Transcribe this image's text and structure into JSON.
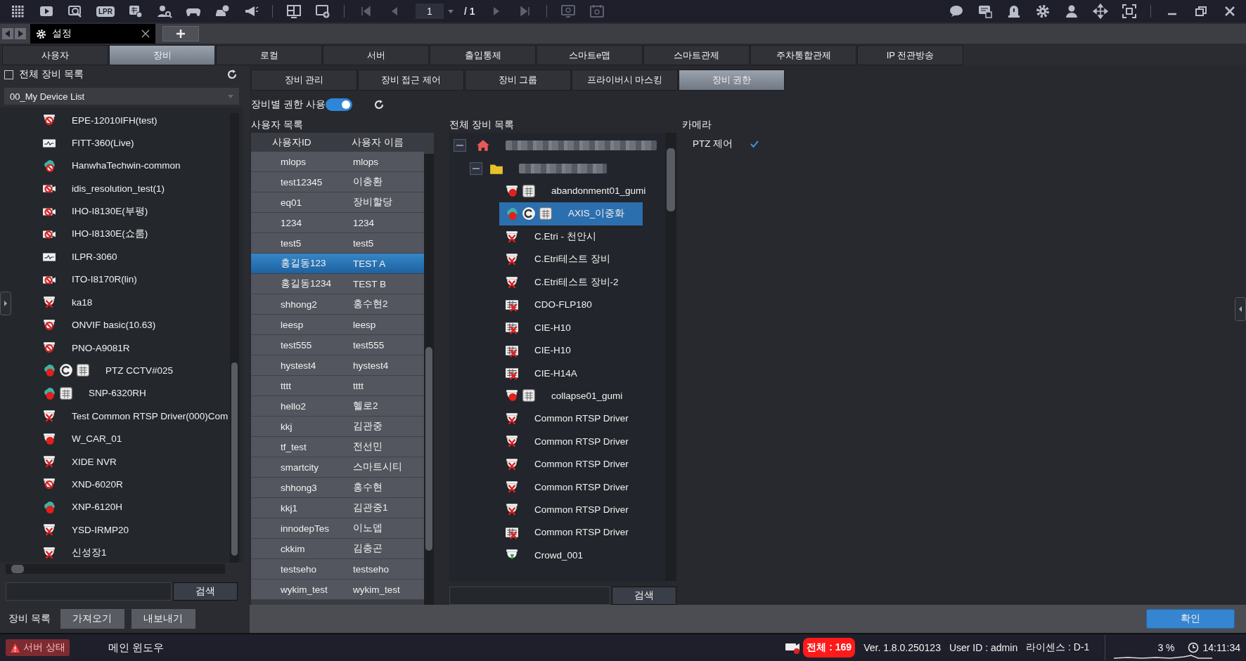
{
  "toolbar": {
    "lpr_label": "LPR",
    "page": "1",
    "page_total": "/ 1"
  },
  "doc_tabs": [
    {
      "label": "설정",
      "selected": true
    }
  ],
  "main_tabs": [
    {
      "label": "사용자",
      "selected": false
    },
    {
      "label": "장비",
      "selected": true
    },
    {
      "label": "로컬",
      "selected": false
    },
    {
      "label": "서버",
      "selected": false
    },
    {
      "label": "출입통제",
      "selected": false
    },
    {
      "label": "스마트e맵",
      "selected": false
    },
    {
      "label": "스마트관제",
      "selected": false
    },
    {
      "label": "주차통합관제",
      "selected": false
    },
    {
      "label": "IP 전관방송",
      "selected": false
    }
  ],
  "left_panel": {
    "all_devices": {
      "label": "전체 장비 목록",
      "checked": false
    },
    "device_list": "00_My Device List",
    "devices": [
      {
        "name": "EPE-12010IFH(test)",
        "kind": "dome-blocked"
      },
      {
        "name": "FITT-360(Live)",
        "kind": "monitor"
      },
      {
        "name": "HanwhaTechwin-common",
        "kind": "cloud-blocked"
      },
      {
        "name": "idis_resolution_test(1)",
        "kind": "box-blocked"
      },
      {
        "name": "IHO-I8130E(부평)",
        "kind": "box-blocked"
      },
      {
        "name": "IHO-I8130E(쇼룸)",
        "kind": "box-blocked"
      },
      {
        "name": "ILPR-3060",
        "kind": "monitor"
      },
      {
        "name": "ITO-I8170R(lin)",
        "kind": "box-blocked"
      },
      {
        "name": "ka18",
        "kind": "dome-x"
      },
      {
        "name": "ONVIF basic(10.63)",
        "kind": "dome-blocked"
      },
      {
        "name": "PNO-A9081R",
        "kind": "dome-blocked"
      },
      {
        "name": "PTZ CCTV#025",
        "kind": "cloud-ptz-grid"
      },
      {
        "name": "SNP-6320RH",
        "kind": "cloud-grid"
      },
      {
        "name": "Test Common RTSP Driver(000)Com",
        "kind": "dome-x"
      },
      {
        "name": "W_CAR_01",
        "kind": "dome-red"
      },
      {
        "name": "XIDE NVR",
        "kind": "dome-x"
      },
      {
        "name": "XND-6020R",
        "kind": "dome-blocked"
      },
      {
        "name": "XNP-6120H",
        "kind": "cloud-red"
      },
      {
        "name": "YSD-IRMP20",
        "kind": "dome-x"
      },
      {
        "name": "신성장1",
        "kind": "dome-x"
      }
    ],
    "search_button": "검색",
    "footer_label": "장비 목록",
    "footer_buttons": [
      "가져오기",
      "내보내기"
    ]
  },
  "sub_tabs": [
    {
      "label": "장비 관리",
      "selected": false
    },
    {
      "label": "장비 접근 제어",
      "selected": false
    },
    {
      "label": "장비 그룹",
      "selected": false
    },
    {
      "label": "프라이버시 마스킹",
      "selected": false
    },
    {
      "label": "장비 권한",
      "selected": true
    }
  ],
  "permission_toggle": {
    "label": "장비별 권한 사용",
    "on": true
  },
  "users": {
    "title": "사용자 목록",
    "columns": [
      "사용자ID",
      "사용자 이름"
    ],
    "rows": [
      {
        "id": "mlops",
        "name": "mlops",
        "selected": false
      },
      {
        "id": "test12345",
        "name": "이충환",
        "selected": false
      },
      {
        "id": "eq01",
        "name": "장비할당",
        "selected": false
      },
      {
        "id": "1234",
        "name": "1234",
        "selected": false
      },
      {
        "id": "test5",
        "name": "test5",
        "selected": false
      },
      {
        "id": "홍길동123",
        "name": "TEST A",
        "selected": true
      },
      {
        "id": "홍길동1234",
        "name": "TEST B",
        "selected": false
      },
      {
        "id": "shhong2",
        "name": "홍수현2",
        "selected": false
      },
      {
        "id": "leesp",
        "name": "leesp",
        "selected": false
      },
      {
        "id": "test555",
        "name": "test555",
        "selected": false
      },
      {
        "id": "hystest4",
        "name": "hystest4",
        "selected": false
      },
      {
        "id": "tttt",
        "name": "tttt",
        "selected": false
      },
      {
        "id": "hello2",
        "name": "헬로2",
        "selected": false
      },
      {
        "id": "kkj",
        "name": "김관중",
        "selected": false
      },
      {
        "id": "tf_test",
        "name": "전선민",
        "selected": false
      },
      {
        "id": "smartcity",
        "name": "스마트시티",
        "selected": false
      },
      {
        "id": "shhong3",
        "name": "홍수현",
        "selected": false
      },
      {
        "id": "kkj1",
        "name": "김관중1",
        "selected": false
      },
      {
        "id": "innodepTes",
        "name": "이노뎁",
        "selected": false
      },
      {
        "id": "ckkim",
        "name": "김충곤",
        "selected": false
      },
      {
        "id": "testseho",
        "name": "testseho",
        "selected": false
      },
      {
        "id": "wykim_test",
        "name": "wykim_test",
        "selected": false
      }
    ]
  },
  "device_tree": {
    "title": "전체 장비 목록",
    "root": {
      "expanded": true,
      "children": [
        {
          "expanded": true,
          "children": [
            {
              "name": "abandonment01_gumi",
              "kind": "dome-red-grid",
              "selected": false
            },
            {
              "name": "AXIS_이중화",
              "kind": "cloud-ptz-grid",
              "selected": true
            },
            {
              "name": "C.Etri - 천안시",
              "kind": "dome-x",
              "selected": false
            },
            {
              "name": "C.Etri테스트 장비",
              "kind": "dome-x",
              "selected": false
            },
            {
              "name": "C.Etri테스트 장비-2",
              "kind": "dome-x",
              "selected": false
            },
            {
              "name": "CDO-FLP180",
              "kind": "encoder-x",
              "selected": false
            },
            {
              "name": "CIE-H10",
              "kind": "encoder-x",
              "selected": false
            },
            {
              "name": "CIE-H10",
              "kind": "encoder-x",
              "selected": false
            },
            {
              "name": "CIE-H14A",
              "kind": "encoder-x",
              "selected": false
            },
            {
              "name": "collapse01_gumi",
              "kind": "dome-red-grid",
              "selected": false
            },
            {
              "name": "Common RTSP Driver",
              "kind": "dome-x",
              "selected": false
            },
            {
              "name": "Common RTSP Driver",
              "kind": "dome-x",
              "selected": false
            },
            {
              "name": "Common RTSP Driver",
              "kind": "dome-x",
              "selected": false
            },
            {
              "name": "Common RTSP Driver",
              "kind": "dome-x",
              "selected": false
            },
            {
              "name": "Common RTSP Driver",
              "kind": "dome-x",
              "selected": false
            },
            {
              "name": "Common RTSP Driver",
              "kind": "encoder-x",
              "selected": false
            },
            {
              "name": "Crowd_001",
              "kind": "dome-green",
              "selected": false
            }
          ]
        }
      ]
    },
    "search_button": "검색"
  },
  "permissions": {
    "title": "카메라",
    "items": [
      {
        "label": "PTZ 제어",
        "checked": true
      }
    ]
  },
  "confirm_button": "확인",
  "status_bar": {
    "server_status": "서버 상태",
    "window": "메인 윈도우",
    "total": "전체 : 169",
    "version": "Ver. 1.8.0.250123",
    "user": "User ID : admin",
    "license": "라이센스 : D-1",
    "cpu": "3 %",
    "time": "14:11:34"
  }
}
